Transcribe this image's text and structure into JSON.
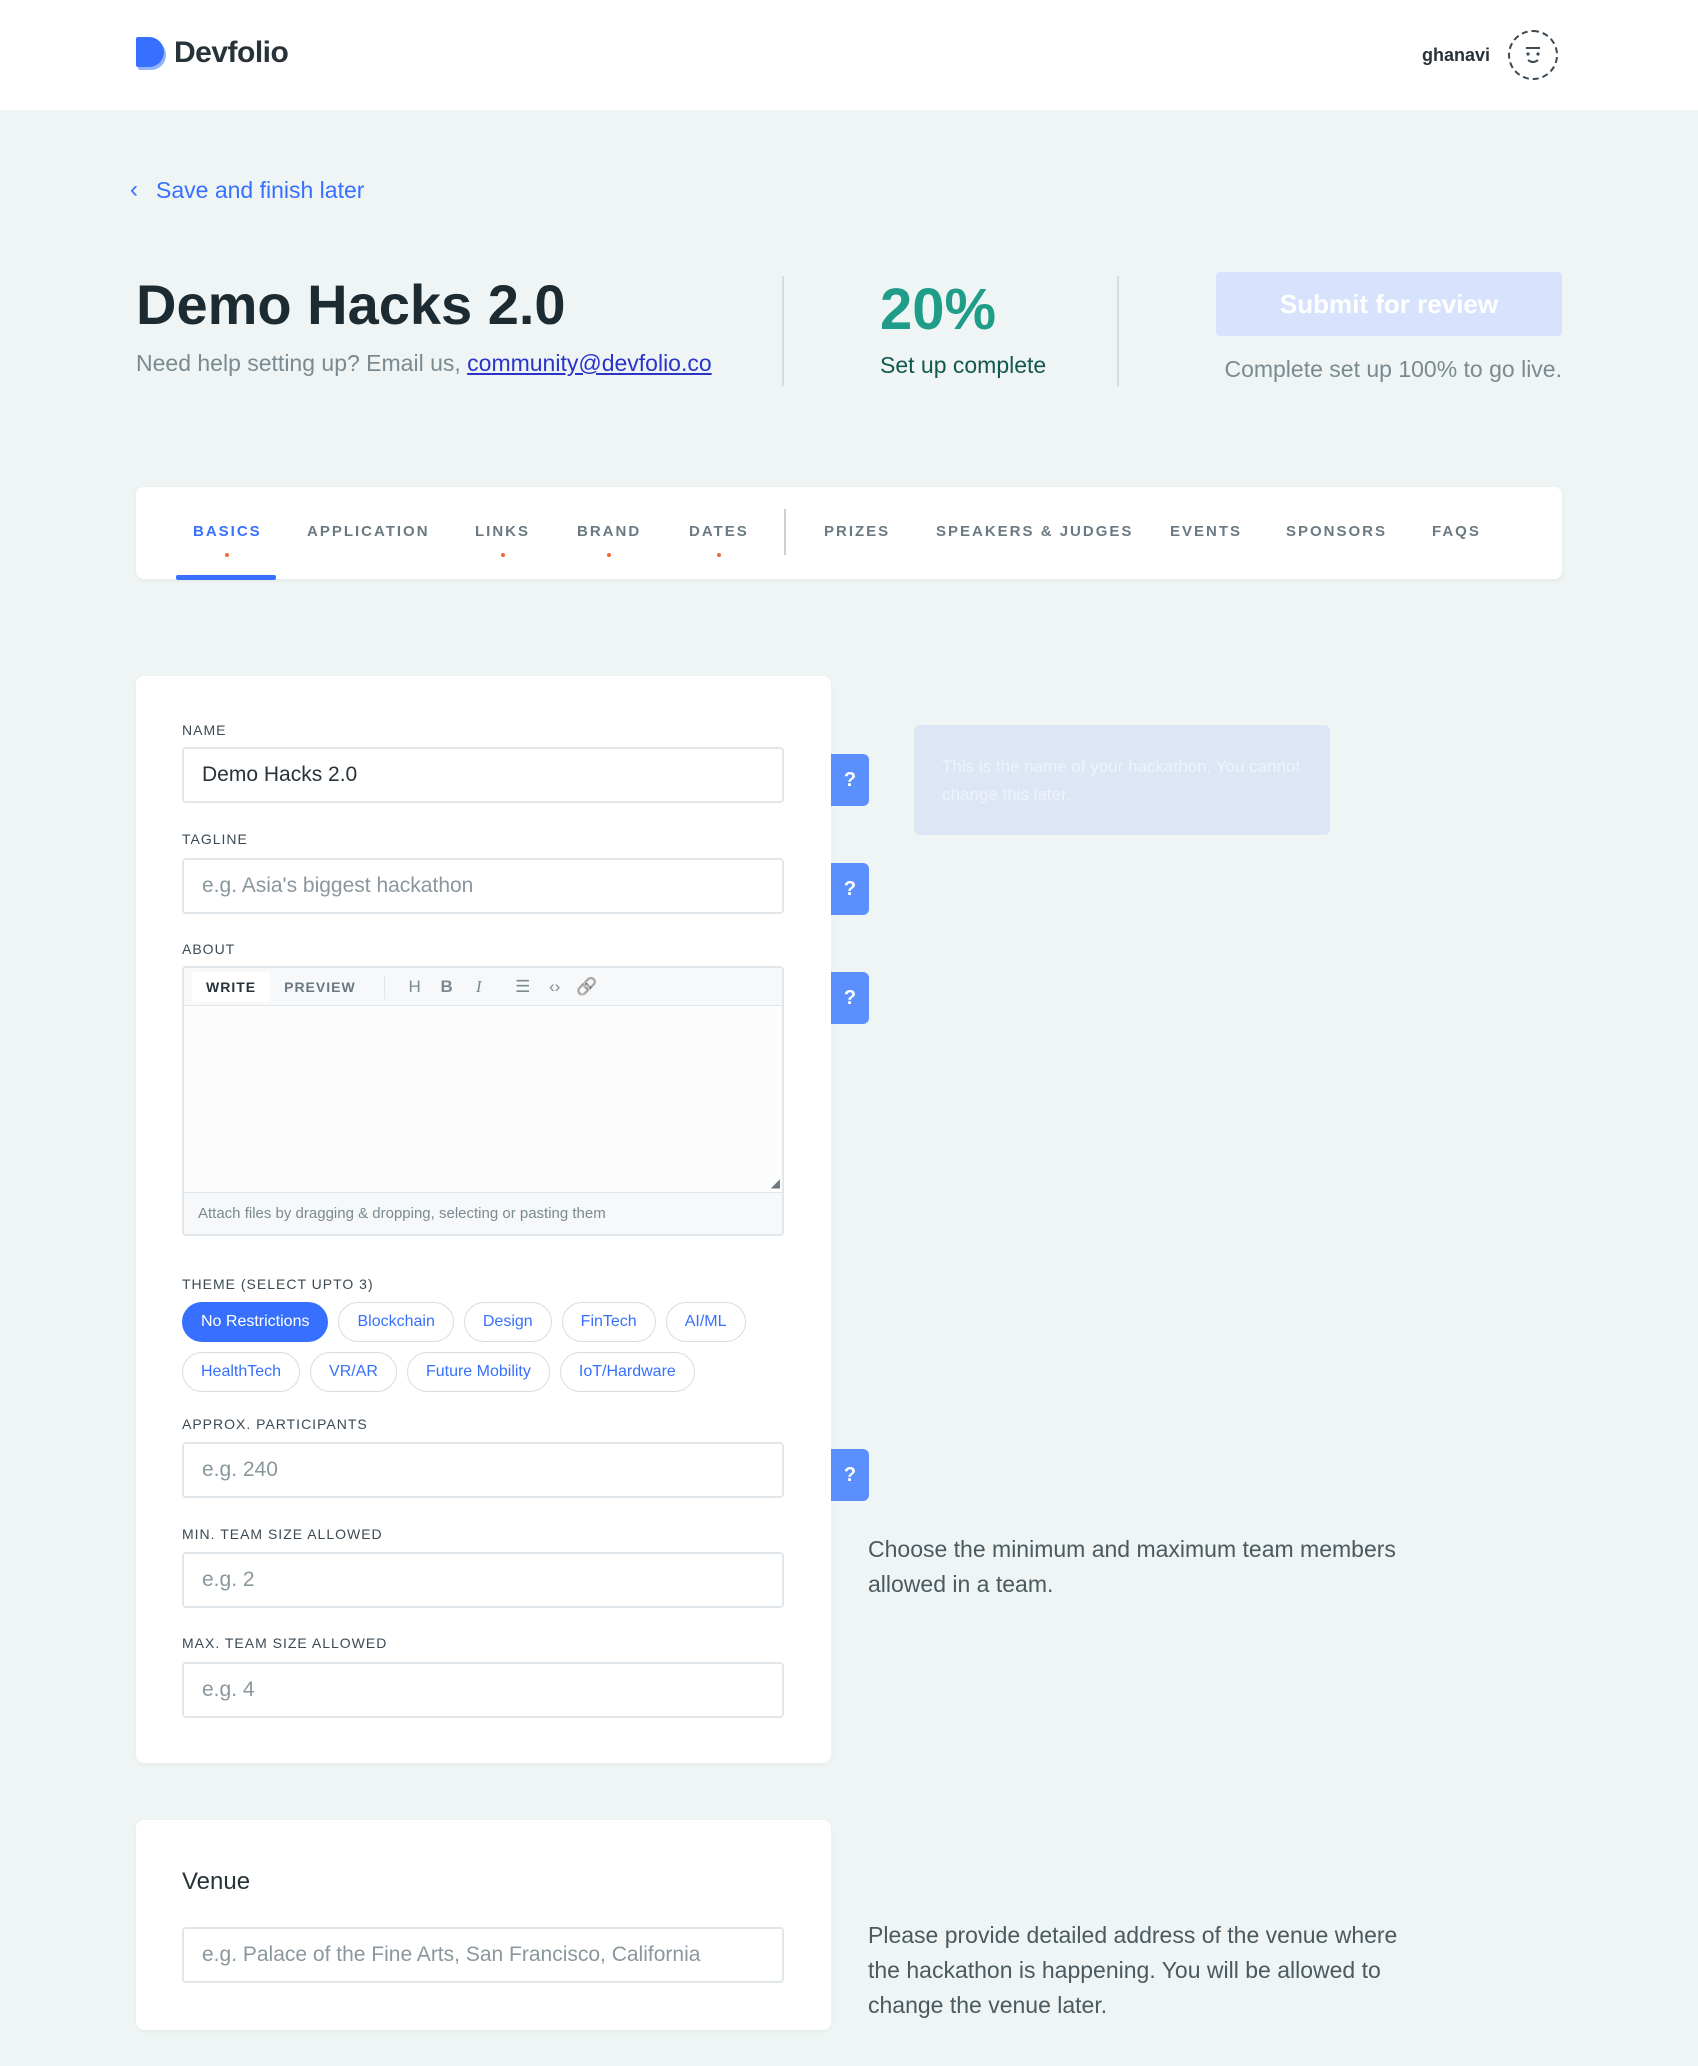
{
  "header": {
    "brand": "Devfolio",
    "username": "ghanavi"
  },
  "nav": {
    "back_label": "Save and finish later"
  },
  "hero": {
    "title": "Demo Hacks 2.0",
    "help_prefix": "Need help setting up? Email us, ",
    "help_email": "community@devfolio.co",
    "progress_value": "20%",
    "progress_label": "Set up complete",
    "submit_label": "Submit for review",
    "submit_note": "Complete set up 100% to go live."
  },
  "tabs": [
    {
      "label": "BASICS",
      "active": true,
      "dot": true
    },
    {
      "label": "APPLICATION",
      "dot": false
    },
    {
      "label": "LINKS",
      "dot": true
    },
    {
      "label": "BRAND",
      "dot": true
    },
    {
      "label": "DATES",
      "dot": true
    },
    {
      "label": "PRIZES",
      "dot": false
    },
    {
      "label": "SPEAKERS & JUDGES",
      "dot": false
    },
    {
      "label": "EVENTS",
      "dot": false
    },
    {
      "label": "SPONSORS",
      "dot": false
    },
    {
      "label": "FAQS",
      "dot": false
    }
  ],
  "form": {
    "name": {
      "label": "NAME",
      "value": "Demo Hacks 2.0"
    },
    "tagline": {
      "label": "TAGLINE",
      "placeholder": "e.g. Asia's biggest hackathon"
    },
    "about": {
      "label": "ABOUT",
      "write_tab": "WRITE",
      "preview_tab": "PREVIEW",
      "tools": [
        "H",
        "B",
        "I",
        "☰",
        "‹›",
        "🔗"
      ],
      "footer": "Attach files by dragging & dropping, selecting or pasting them"
    },
    "theme": {
      "label": "THEME (SELECT UPTO 3)",
      "row1": [
        "No Restrictions",
        "Blockchain",
        "Design",
        "FinTech",
        "AI/ML"
      ],
      "row2": [
        "HealthTech",
        "VR/AR",
        "Future Mobility",
        "IoT/Hardware"
      ],
      "selected": "No Restrictions"
    },
    "participants": {
      "label": "APPROX. PARTICIPANTS",
      "placeholder": "e.g. 240"
    },
    "min_team": {
      "label": "MIN. TEAM SIZE ALLOWED",
      "placeholder": "e.g. 2"
    },
    "max_team": {
      "label": "MAX. TEAM SIZE ALLOWED",
      "placeholder": "e.g. 4"
    },
    "help_glyph": "?"
  },
  "tooltip": {
    "text": "This is the name of your hackathon. You cannot change this later."
  },
  "team_help": "Choose the minimum and maximum team members allowed in a team.",
  "venue": {
    "title": "Venue",
    "placeholder": "e.g. Palace of the Fine Arts, San Francisco, California",
    "help": "Please provide detailed address of the venue where the hackathon is happening. You will be allowed to change the venue later."
  },
  "colors": {
    "accent": "#3770ff",
    "progress": "#1f9d89",
    "dot": "#f06a3b",
    "background": "#eff5f4"
  }
}
